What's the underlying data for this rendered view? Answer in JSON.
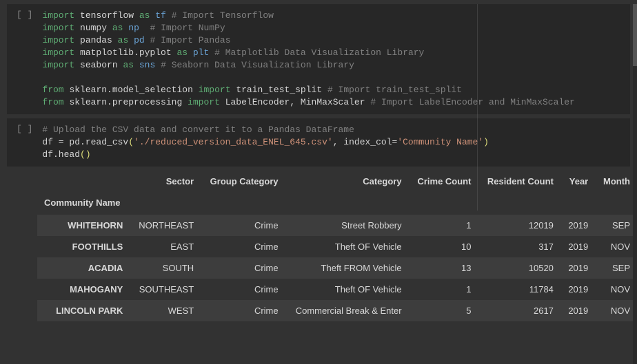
{
  "cells": [
    {
      "prompt": "[ ]",
      "lines": [
        [
          [
            "kw",
            "import"
          ],
          [
            "sp",
            " "
          ],
          [
            "mod",
            "tensorflow"
          ],
          [
            "sp",
            " "
          ],
          [
            "kw",
            "as"
          ],
          [
            "sp",
            " "
          ],
          [
            "alias",
            "tf"
          ],
          [
            "sp",
            " "
          ],
          [
            "cmt",
            "# Import Tensorflow"
          ]
        ],
        [
          [
            "kw",
            "import"
          ],
          [
            "sp",
            " "
          ],
          [
            "mod",
            "numpy"
          ],
          [
            "sp",
            " "
          ],
          [
            "kw",
            "as"
          ],
          [
            "sp",
            " "
          ],
          [
            "alias",
            "np"
          ],
          [
            "sp",
            "  "
          ],
          [
            "cmt",
            "# Import NumPy"
          ]
        ],
        [
          [
            "kw",
            "import"
          ],
          [
            "sp",
            " "
          ],
          [
            "mod",
            "pandas"
          ],
          [
            "sp",
            " "
          ],
          [
            "kw",
            "as"
          ],
          [
            "sp",
            " "
          ],
          [
            "alias",
            "pd"
          ],
          [
            "sp",
            " "
          ],
          [
            "cmt",
            "# Import Pandas"
          ]
        ],
        [
          [
            "kw",
            "import"
          ],
          [
            "sp",
            " "
          ],
          [
            "mod",
            "matplotlib.pyplot"
          ],
          [
            "sp",
            " "
          ],
          [
            "kw",
            "as"
          ],
          [
            "sp",
            " "
          ],
          [
            "alias",
            "plt"
          ],
          [
            "sp",
            " "
          ],
          [
            "cmt",
            "# Matplotlib Data Visualization Library"
          ]
        ],
        [
          [
            "kw",
            "import"
          ],
          [
            "sp",
            " "
          ],
          [
            "mod",
            "seaborn"
          ],
          [
            "sp",
            " "
          ],
          [
            "kw",
            "as"
          ],
          [
            "sp",
            " "
          ],
          [
            "alias",
            "sns"
          ],
          [
            "sp",
            " "
          ],
          [
            "cmt",
            "# Seaborn Data Visualization Library"
          ]
        ],
        [],
        [
          [
            "kw",
            "from"
          ],
          [
            "sp",
            " "
          ],
          [
            "mod",
            "sklearn.model_selection"
          ],
          [
            "sp",
            " "
          ],
          [
            "kw",
            "import"
          ],
          [
            "sp",
            " "
          ],
          [
            "mod",
            "train_test_split"
          ],
          [
            "sp",
            " "
          ],
          [
            "cmt",
            "# Import train_test_split"
          ]
        ],
        [
          [
            "kw",
            "from"
          ],
          [
            "sp",
            " "
          ],
          [
            "mod",
            "sklearn.preprocessing"
          ],
          [
            "sp",
            " "
          ],
          [
            "kw",
            "import"
          ],
          [
            "sp",
            " "
          ],
          [
            "mod",
            "LabelEncoder, MinMaxScaler"
          ],
          [
            "sp",
            " "
          ],
          [
            "cmt",
            "# Import LabelEncoder and MinMaxScaler"
          ]
        ]
      ]
    },
    {
      "prompt": "[ ]",
      "lines": [
        [
          [
            "cmt",
            "# Upload the CSV data and convert it to a Pandas DataFrame"
          ]
        ],
        [
          [
            "mod",
            "df = pd.read_csv"
          ],
          [
            "paren",
            "("
          ],
          [
            "str",
            "'./reduced_version_data_ENEL_645.csv'"
          ],
          [
            "mod",
            ", index_col="
          ],
          [
            "str",
            "'Community Name'"
          ],
          [
            "paren",
            ")"
          ]
        ],
        [
          [
            "mod",
            "df.head"
          ],
          [
            "paren",
            "()"
          ]
        ]
      ]
    }
  ],
  "table": {
    "index_name": "Community Name",
    "columns": [
      "Sector",
      "Group Category",
      "Category",
      "Crime Count",
      "Resident Count",
      "Year",
      "Month"
    ],
    "rows": [
      {
        "index": "WHITEHORN",
        "cells": [
          "NORTHEAST",
          "Crime",
          "Street Robbery",
          "1",
          "12019",
          "2019",
          "SEP"
        ]
      },
      {
        "index": "FOOTHILLS",
        "cells": [
          "EAST",
          "Crime",
          "Theft OF Vehicle",
          "10",
          "317",
          "2019",
          "NOV"
        ]
      },
      {
        "index": "ACADIA",
        "cells": [
          "SOUTH",
          "Crime",
          "Theft FROM Vehicle",
          "13",
          "10520",
          "2019",
          "SEP"
        ]
      },
      {
        "index": "MAHOGANY",
        "cells": [
          "SOUTHEAST",
          "Crime",
          "Theft OF Vehicle",
          "1",
          "11784",
          "2019",
          "NOV"
        ]
      },
      {
        "index": "LINCOLN PARK",
        "cells": [
          "WEST",
          "Crime",
          "Commercial Break & Enter",
          "5",
          "2617",
          "2019",
          "NOV"
        ]
      }
    ]
  }
}
